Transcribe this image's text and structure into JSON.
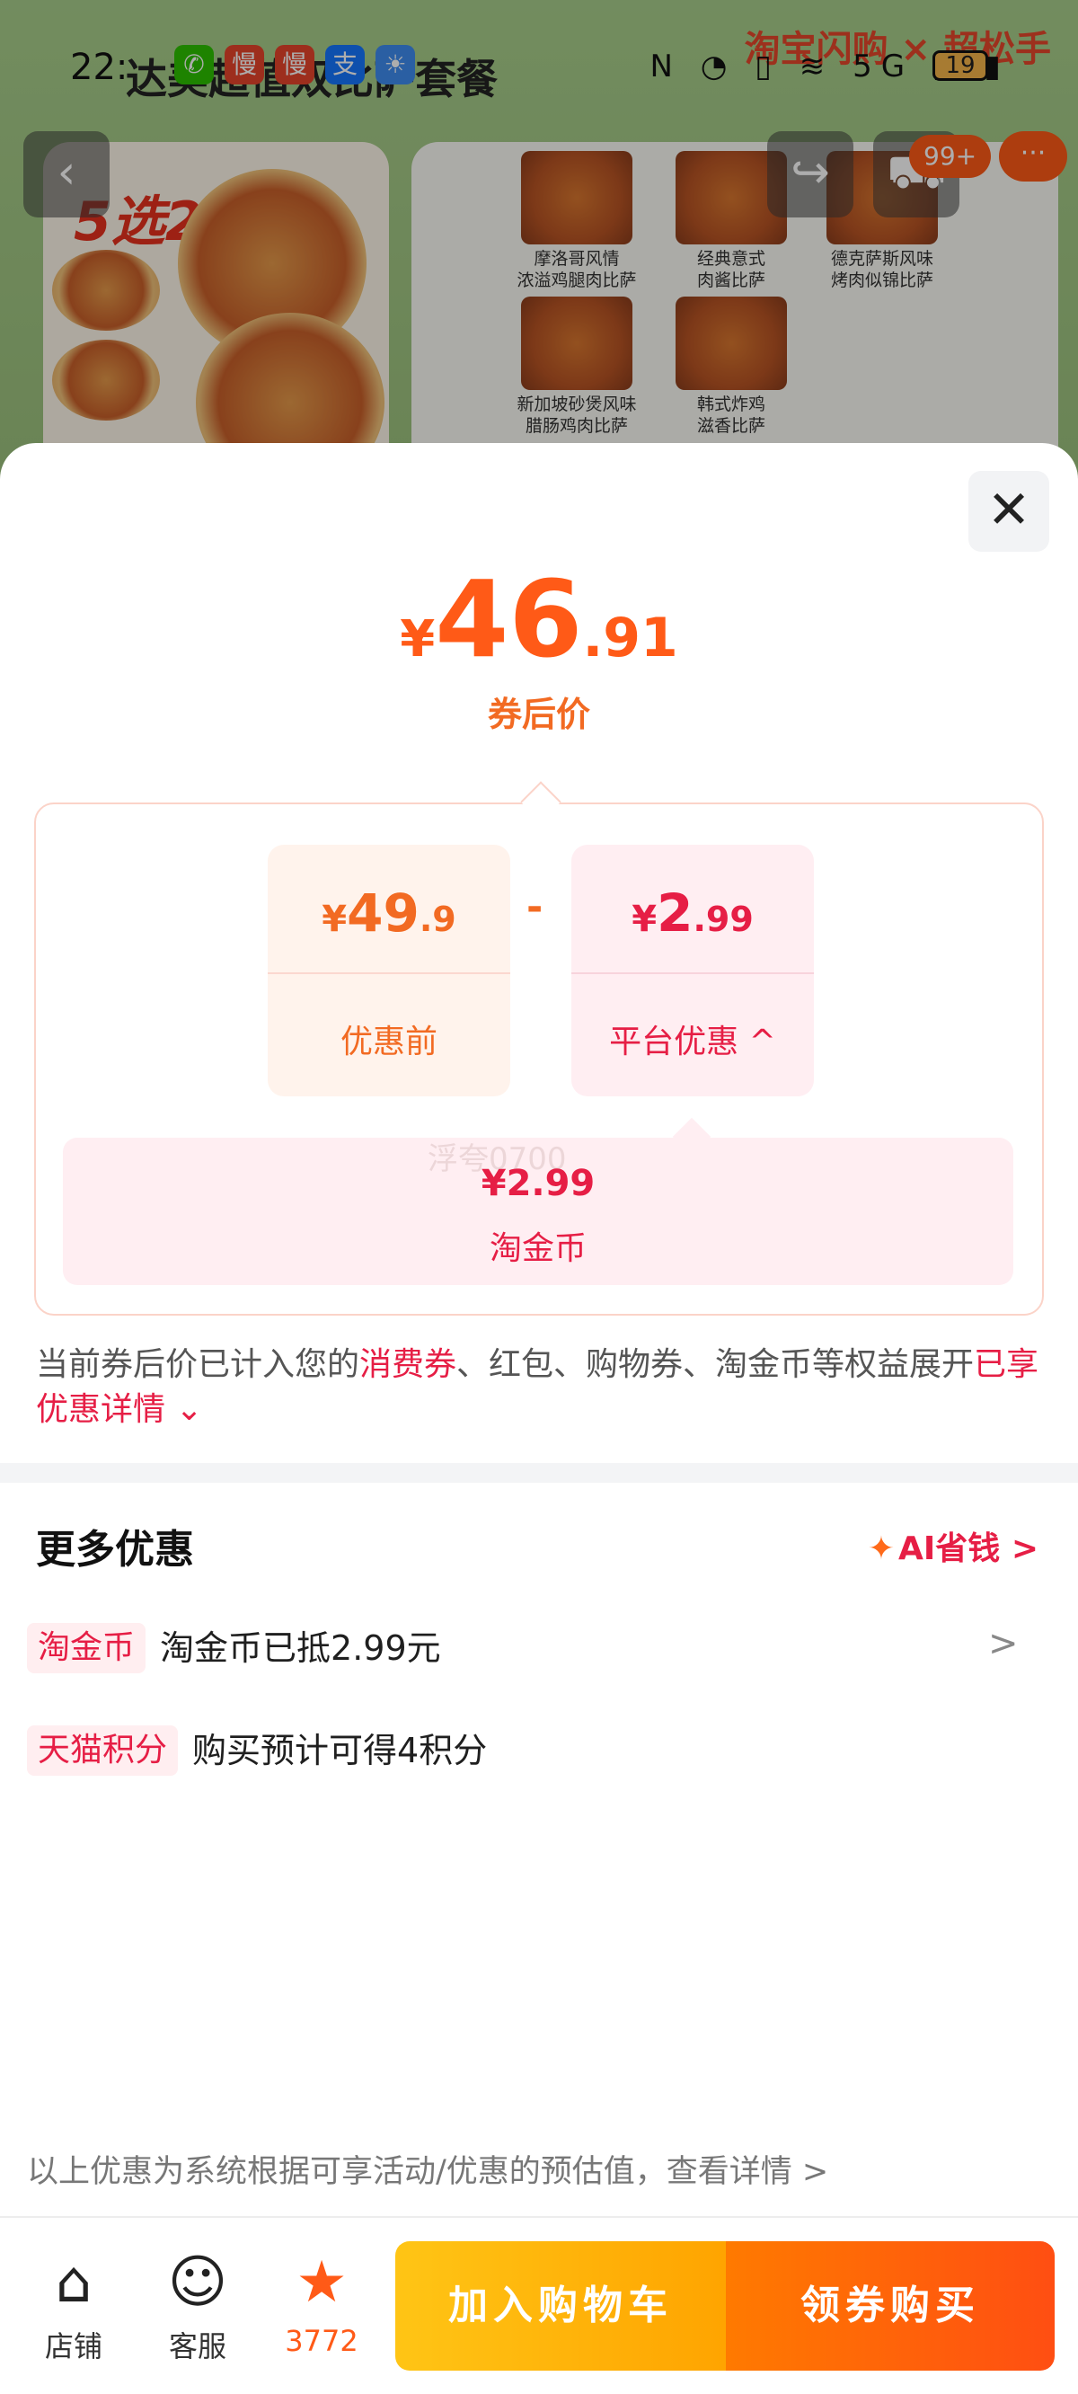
{
  "background": {
    "status_time": "22:",
    "product_title": "达美超值双比萨套餐",
    "brand_badge": "淘宝闪购 × 超松手",
    "battery": "19",
    "cart_badge": "99+",
    "menu_dots": "···",
    "promo_tag": "5选2",
    "thumbnails": [
      {
        "caption": "摩洛哥风情\n浓溢鸡腿肉比萨"
      },
      {
        "caption": "经典意式\n肉酱比萨"
      },
      {
        "caption": "德克萨斯风味\n烤肉似锦比萨"
      },
      {
        "caption": "新加坡砂煲风味\n腊肠鸡肉比萨"
      },
      {
        "caption": "韩式炸鸡\n滋香比萨"
      }
    ]
  },
  "sheet": {
    "close_icon": "close-icon",
    "final_price": {
      "currency": "¥",
      "integer": "46",
      "decimal": ".91"
    },
    "final_price_label": "券后价",
    "original": {
      "currency": "¥",
      "integer": "49",
      "decimal": ".9",
      "label": "优惠前"
    },
    "operator": "-",
    "discount": {
      "currency": "¥",
      "integer": "2",
      "decimal": ".99",
      "label": "平台优惠",
      "chevron": "^"
    },
    "discount_detail": {
      "amount": "¥2.99",
      "label": "淘金币"
    },
    "watermark": "浮夸0700",
    "note": {
      "part1": "当前券后价已计入您的",
      "highlight1": "消费券",
      "part2": "、红包、购物券、淘金币等权益展开",
      "highlight2": "已享优惠详情",
      "chevron": "⌄"
    },
    "more": {
      "title": "更多优惠",
      "ai_label": "AI省钱",
      "ai_chevron": ">",
      "rows": [
        {
          "tag": "淘金币",
          "text": "淘金币已抵2.99元",
          "arrow": ">"
        },
        {
          "tag": "天猫积分",
          "text": "购买预计可得4积分"
        }
      ]
    },
    "disclaimer": "以上优惠为系统根据可享活动/优惠的预估值，查看详情 >"
  },
  "action_bar": {
    "store_label": "店铺",
    "service_label": "客服",
    "favorite_count": "3772",
    "add_cart_label": "加入购物车",
    "buy_label": "领券购买"
  },
  "colors": {
    "accent_orange": "#ff5a17",
    "accent_red": "#e61e45",
    "cart_button": "#ffb300",
    "buy_button": "#ff5a12"
  }
}
